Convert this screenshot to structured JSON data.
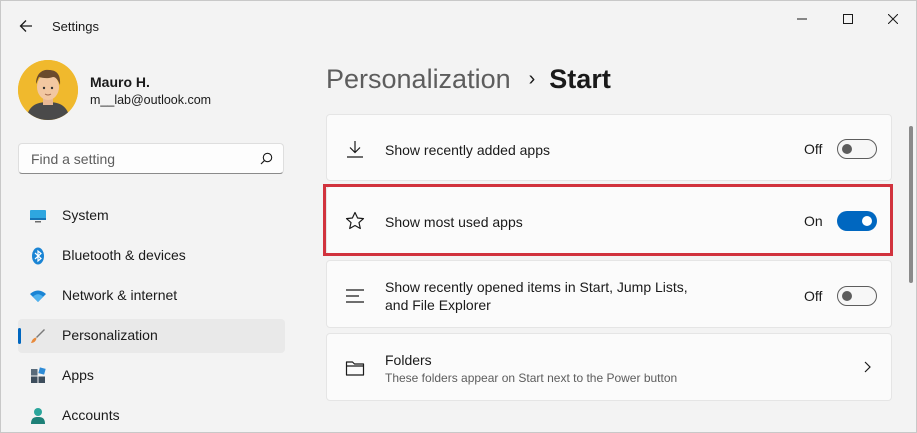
{
  "window": {
    "title": "Settings"
  },
  "profile": {
    "name": "Mauro H.",
    "email": "m__lab@outlook.com"
  },
  "search": {
    "placeholder": "Find a setting"
  },
  "nav": {
    "items": [
      {
        "label": "System",
        "icon": "monitor-icon"
      },
      {
        "label": "Bluetooth & devices",
        "icon": "bluetooth-icon"
      },
      {
        "label": "Network & internet",
        "icon": "wifi-icon"
      },
      {
        "label": "Personalization",
        "icon": "paintbrush-icon",
        "active": true
      },
      {
        "label": "Apps",
        "icon": "apps-icon"
      },
      {
        "label": "Accounts",
        "icon": "person-icon"
      }
    ]
  },
  "breadcrumb": {
    "parent": "Personalization",
    "separator": "›",
    "current": "Start"
  },
  "settings": {
    "recently_added": {
      "label": "Show recently added apps",
      "state": "Off",
      "icon": "download-icon"
    },
    "most_used": {
      "label": "Show most used apps",
      "state": "On",
      "icon": "star-icon"
    },
    "recently_opened": {
      "label_line1": "Show recently opened items in Start, Jump Lists,",
      "label_line2": "and File Explorer",
      "state": "Off",
      "icon": "list-icon"
    },
    "folders": {
      "label": "Folders",
      "description": "These folders appear on Start next to the Power button",
      "icon": "folder-icon"
    }
  },
  "colors": {
    "accent": "#0067c0",
    "highlight": "#d1323d",
    "avatar_bg": "#f0b92d"
  }
}
